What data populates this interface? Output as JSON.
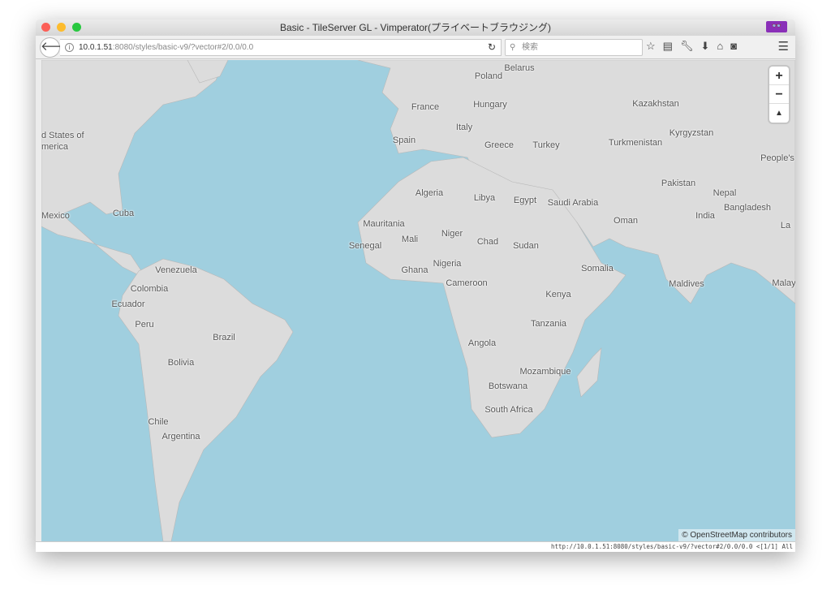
{
  "window": {
    "title": "Basic - TileServer GL - Vimperator(プライベートブラウジング)",
    "private_badge": "👓"
  },
  "toolbar": {
    "url_host": "10.0.1.51",
    "url_rest": ":8080/styles/basic-v9/?vector#2/0.0/0.0",
    "search_placeholder": "検索",
    "icons": [
      "star-icon",
      "reading-list-icon",
      "wrench-icon",
      "download-icon",
      "home-icon",
      "pocket-icon"
    ]
  },
  "map": {
    "zoom_in": "+",
    "zoom_out": "−",
    "compass": "▲",
    "attribution": "© OpenStreetMap contributors",
    "labels": [
      "Belarus",
      "Poland",
      "France",
      "Hungary",
      "Kazakhstan",
      "Italy",
      "Kyrgyzstan",
      "Spain",
      "Greece",
      "Turkey",
      "Turkmenistan",
      "People's",
      "d States of",
      "merica",
      "Algeria",
      "Libya",
      "Egypt",
      "Saudi Arabia",
      "Pakistan",
      "Nepal",
      "Bangladesh",
      "India",
      "Oman",
      "Mexico",
      "Cuba",
      "Mauritania",
      "Mali",
      "Niger",
      "Chad",
      "Sudan",
      "Senegal",
      "Ghana",
      "Nigeria",
      "Somalia",
      "Venezuela",
      "Colombia",
      "Cameroon",
      "Maldives",
      "Malay",
      "Ecuador",
      "Kenya",
      "Peru",
      "Brazil",
      "Tanzania",
      "Angola",
      "Bolivia",
      "Mozambique",
      "Botswana",
      "South Africa",
      "Chile",
      "Argentina",
      "La"
    ],
    "colors": {
      "water": "#a0cfdf",
      "land": "#dcdcdc"
    }
  },
  "status": {
    "text": "http://10.0.1.51:8080/styles/basic-v9/?vector#2/0.0/0.0 <[1/1] All"
  }
}
